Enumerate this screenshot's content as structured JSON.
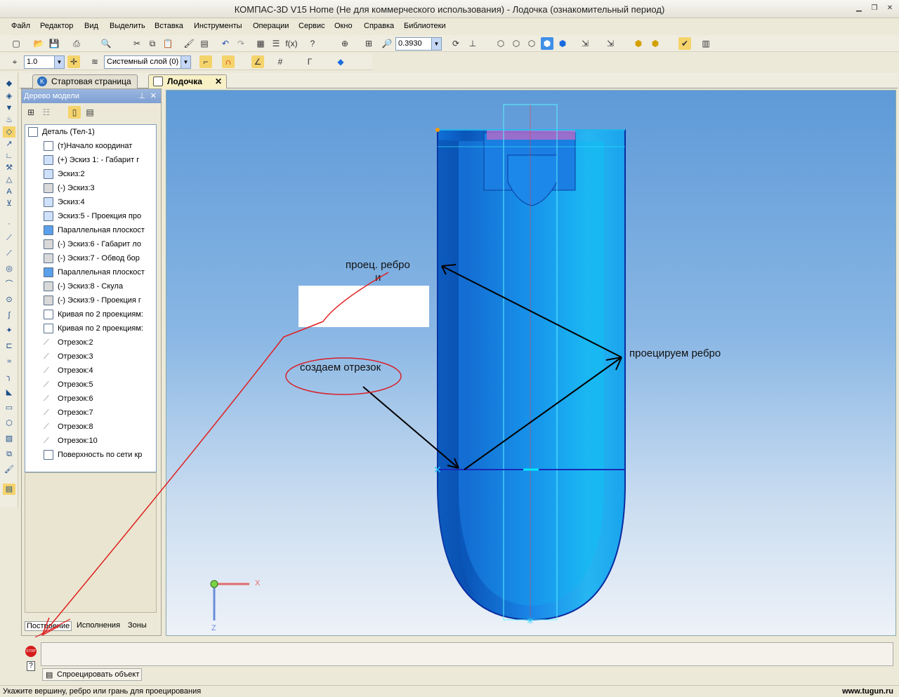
{
  "window": {
    "title": "КОМПАС-3D V15 Home (Не для коммерческого использования) - Лодочка (ознакомительный период)"
  },
  "menu": [
    "Файл",
    "Редактор",
    "Вид",
    "Выделить",
    "Вставка",
    "Инструменты",
    "Операции",
    "Сервис",
    "Окно",
    "Справка",
    "Библиотеки"
  ],
  "toolbar": {
    "zoom_value": "0.3930",
    "scale_value": "1.0",
    "layer_value": "Системный слой (0)"
  },
  "tabs": [
    {
      "label": "Стартовая страница"
    },
    {
      "label": "Лодочка"
    }
  ],
  "tree": {
    "title": "Дерево модели",
    "items": [
      "Деталь (Тел-1)",
      "(т)Начало координат",
      "(+) Эскиз 1: - Габарит г",
      "Эскиз:2",
      "(-) Эскиз:3",
      "Эскиз:4",
      "Эскиз:5 - Проекция про",
      "Параллельная плоскост",
      "(-) Эскиз:6 - Габарит ло",
      "(-) Эскиз:7 - Обвод бор",
      "Параллельная плоскост",
      "(-) Эскиз:8 - Скула",
      "(-) Эскиз:9 - Проекция г",
      "Кривая по 2 проекциям:",
      "Кривая по 2 проекциям:",
      "Отрезок:2",
      "Отрезок:3",
      "Отрезок:4",
      "Отрезок:5",
      "Отрезок:6",
      "Отрезок:7",
      "Отрезок:8",
      "Отрезок:10",
      "Поверхность по сети кр"
    ]
  },
  "panel_tabs": [
    "Построение",
    "Исполнения",
    "Зоны"
  ],
  "annotations": {
    "proj_edge": "проец. ребро",
    "and": "и",
    "proj_edge2": "проецируем ребро",
    "create_segment": "создаем отрезок"
  },
  "axes": {
    "x": "X",
    "z": "Z"
  },
  "command": {
    "button": "Спроецировать объект",
    "stop": "STOP"
  },
  "status": {
    "hint": "Укажите вершину, ребро или грань для проецирования",
    "watermark": "www.tugun.ru"
  }
}
